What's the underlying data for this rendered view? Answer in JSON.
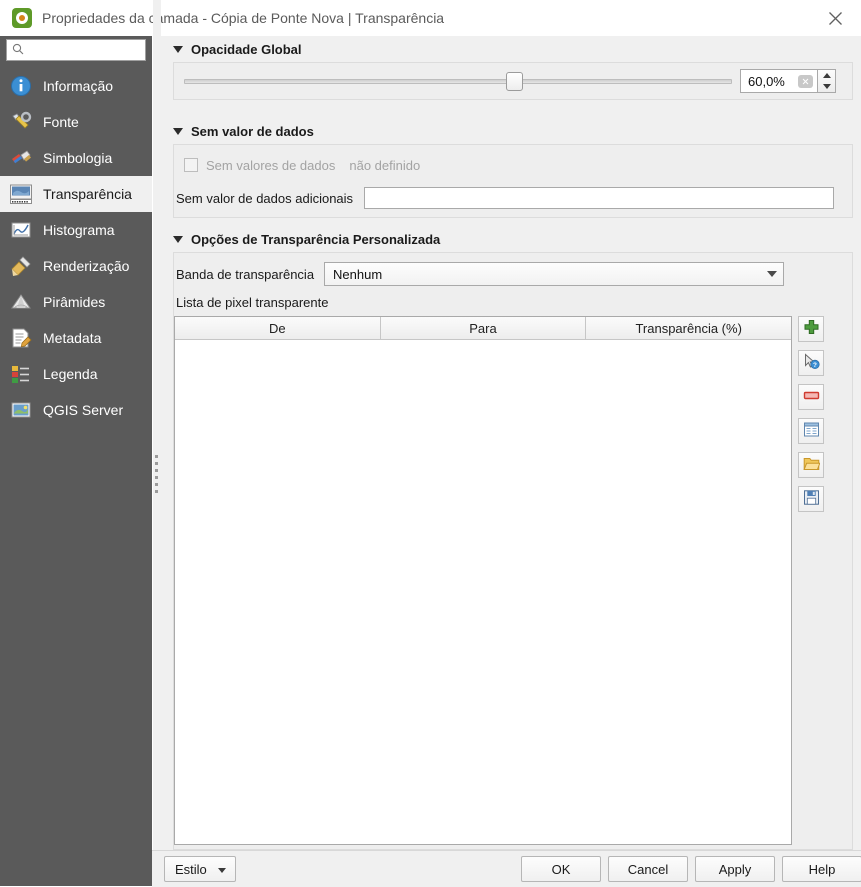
{
  "window": {
    "title": "Propriedades da camada - Cópia de Ponte Nova | Transparência",
    "app_icon": "qgis-logo-icon",
    "close_icon": "close-icon"
  },
  "sidebar": {
    "search": {
      "value": "",
      "placeholder": "",
      "icon": "search-icon"
    },
    "items": [
      {
        "label": "Informação",
        "icon": "info-icon",
        "selected": false
      },
      {
        "label": "Fonte",
        "icon": "source-icon",
        "selected": false
      },
      {
        "label": "Simbologia",
        "icon": "symbology-icon",
        "selected": false
      },
      {
        "label": "Transparência",
        "icon": "transparency-icon",
        "selected": true
      },
      {
        "label": "Histograma",
        "icon": "histogram-icon",
        "selected": false
      },
      {
        "label": "Renderização",
        "icon": "rendering-icon",
        "selected": false
      },
      {
        "label": "Pirâmides",
        "icon": "pyramids-icon",
        "selected": false
      },
      {
        "label": "Metadata",
        "icon": "metadata-icon",
        "selected": false
      },
      {
        "label": "Legenda",
        "icon": "legend-icon",
        "selected": false
      },
      {
        "label": "QGIS Server",
        "icon": "qgis-server-icon",
        "selected": false
      }
    ]
  },
  "opacity": {
    "group_title": "Opacidade Global",
    "value": "60,0%",
    "slider_percent": 60,
    "clear_icon": "clear-icon",
    "spin_up_icon": "spin-up-icon",
    "spin_down_icon": "spin-down-icon"
  },
  "nodata": {
    "group_title": "Sem valor de dados",
    "checkbox_label": "Sem valores de dados",
    "checkbox_state": "unchecked",
    "checkbox_enabled": false,
    "status_text": "não definido",
    "additional_label": "Sem valor de dados adicionais",
    "additional_value": "",
    "additional_placeholder": ""
  },
  "custom": {
    "group_title": "Opções de Transparência Personalizada",
    "band_label": "Banda de transparência",
    "band_value": "Nenhum",
    "list_label": "Lista de pixel transparente",
    "table": {
      "columns": [
        "De",
        "Para",
        "Transparência (%)"
      ],
      "rows": []
    },
    "tools": [
      {
        "name": "add-values-manually-button",
        "icon": "green-plus-icon"
      },
      {
        "name": "add-values-from-display-button",
        "icon": "cursor-question-icon"
      },
      {
        "name": "remove-selected-row-button",
        "icon": "red-minus-icon"
      },
      {
        "name": "default-values-button",
        "icon": "table-icon"
      },
      {
        "name": "import-from-file-button",
        "icon": "folder-open-icon"
      },
      {
        "name": "export-to-file-button",
        "icon": "floppy-save-icon"
      }
    ]
  },
  "footer": {
    "style_label": "Estilo",
    "ok_label": "OK",
    "cancel_label": "Cancel",
    "apply_label": "Apply",
    "help_label": "Help"
  },
  "colors": {
    "sidebar_bg": "#5a5a5a",
    "panel_bg": "#f0f0f0",
    "accent_green": "#5e9a28",
    "selected_item_bg": "#f0f0f0"
  }
}
